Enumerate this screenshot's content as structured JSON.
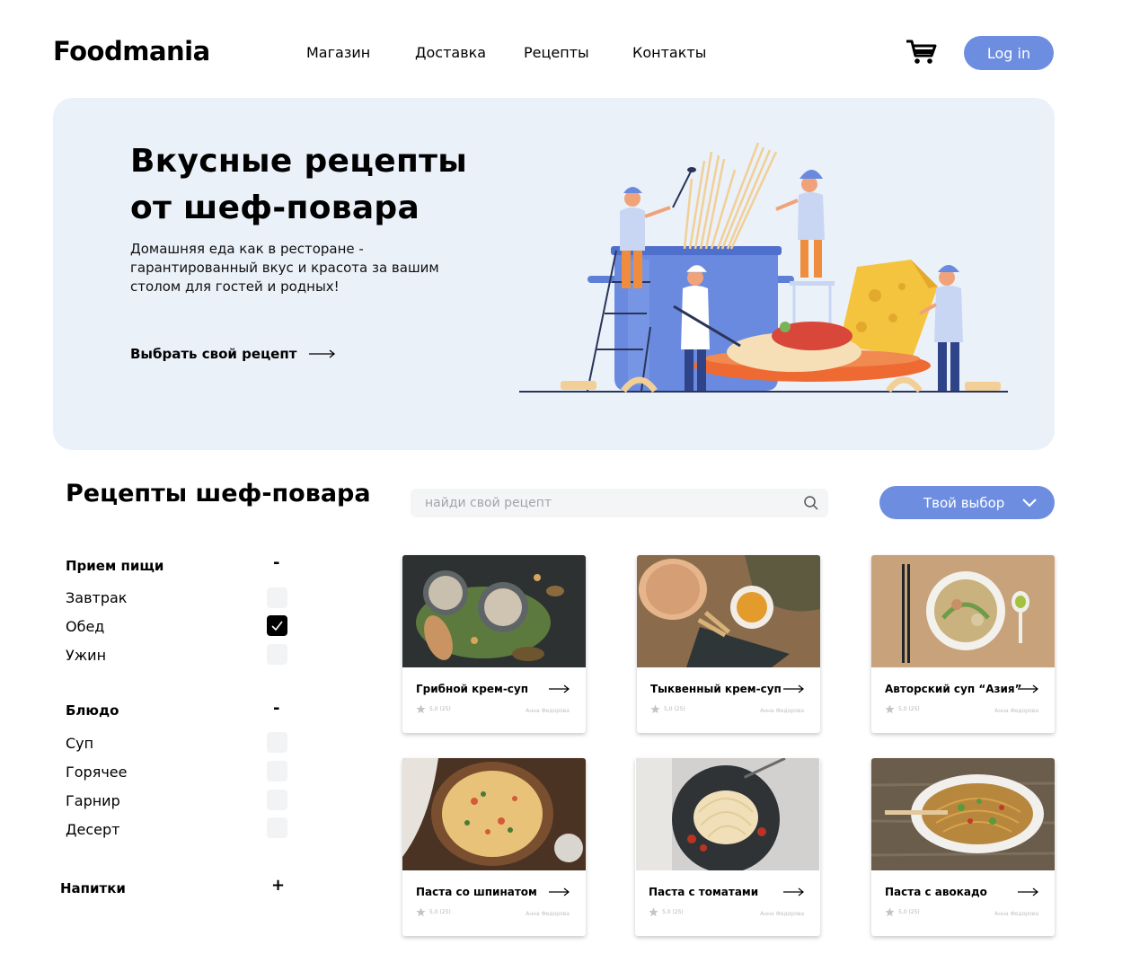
{
  "header": {
    "logo": "Foodmania",
    "nav": [
      "Магазин",
      "Доставка",
      "Рецепты",
      "Контакты"
    ],
    "login_label": "Log in"
  },
  "hero": {
    "title_line1": "Вкусные рецепты",
    "title_line2": "от шеф-повара",
    "description": "Домашняя еда как в ресторане - гарантированный вкус и красота за вашим столом для гостей и родных!",
    "cta": "Выбрать свой рецепт"
  },
  "section": {
    "title": "Рецепты шеф-повара",
    "search_placeholder": "найди свой рецепт",
    "choice_label": "Твой выбор"
  },
  "filters": [
    {
      "title": "Прием пищи",
      "toggle": "-",
      "items": [
        {
          "label": "Завтрак",
          "checked": false
        },
        {
          "label": "Обед",
          "checked": true
        },
        {
          "label": "Ужин",
          "checked": false
        }
      ]
    },
    {
      "title": "Блюдо",
      "toggle": "-",
      "items": [
        {
          "label": "Суп",
          "checked": false
        },
        {
          "label": "Горячее",
          "checked": false
        },
        {
          "label": "Гарнир",
          "checked": false
        },
        {
          "label": "Десерт",
          "checked": false
        }
      ]
    },
    {
      "title": "Напитки",
      "toggle": "+",
      "items": []
    }
  ],
  "recipes": [
    {
      "title": "Грибной крем-суп",
      "rating": "5,0 (25)",
      "author": "Анна Федорова"
    },
    {
      "title": "Тыквенный крем-суп",
      "rating": "5,0 (25)",
      "author": "Анна Федорова"
    },
    {
      "title": "Авторский суп “Азия”",
      "rating": "5,0 (25)",
      "author": "Анна Федорова"
    },
    {
      "title": "Паста со шпинатом",
      "rating": "5,0 (25)",
      "author": "Анна Федорова"
    },
    {
      "title": "Паста с томатами",
      "rating": "5,0 (25)",
      "author": "Анна Федорова"
    },
    {
      "title": "Паста с авокадо",
      "rating": "5,0 (25)",
      "author": "Анна Федорова"
    }
  ],
  "colors": {
    "accent": "#6d8ee0",
    "hero_bg": "#ebf1f9",
    "checkbox_bg": "#f2f3f5"
  }
}
